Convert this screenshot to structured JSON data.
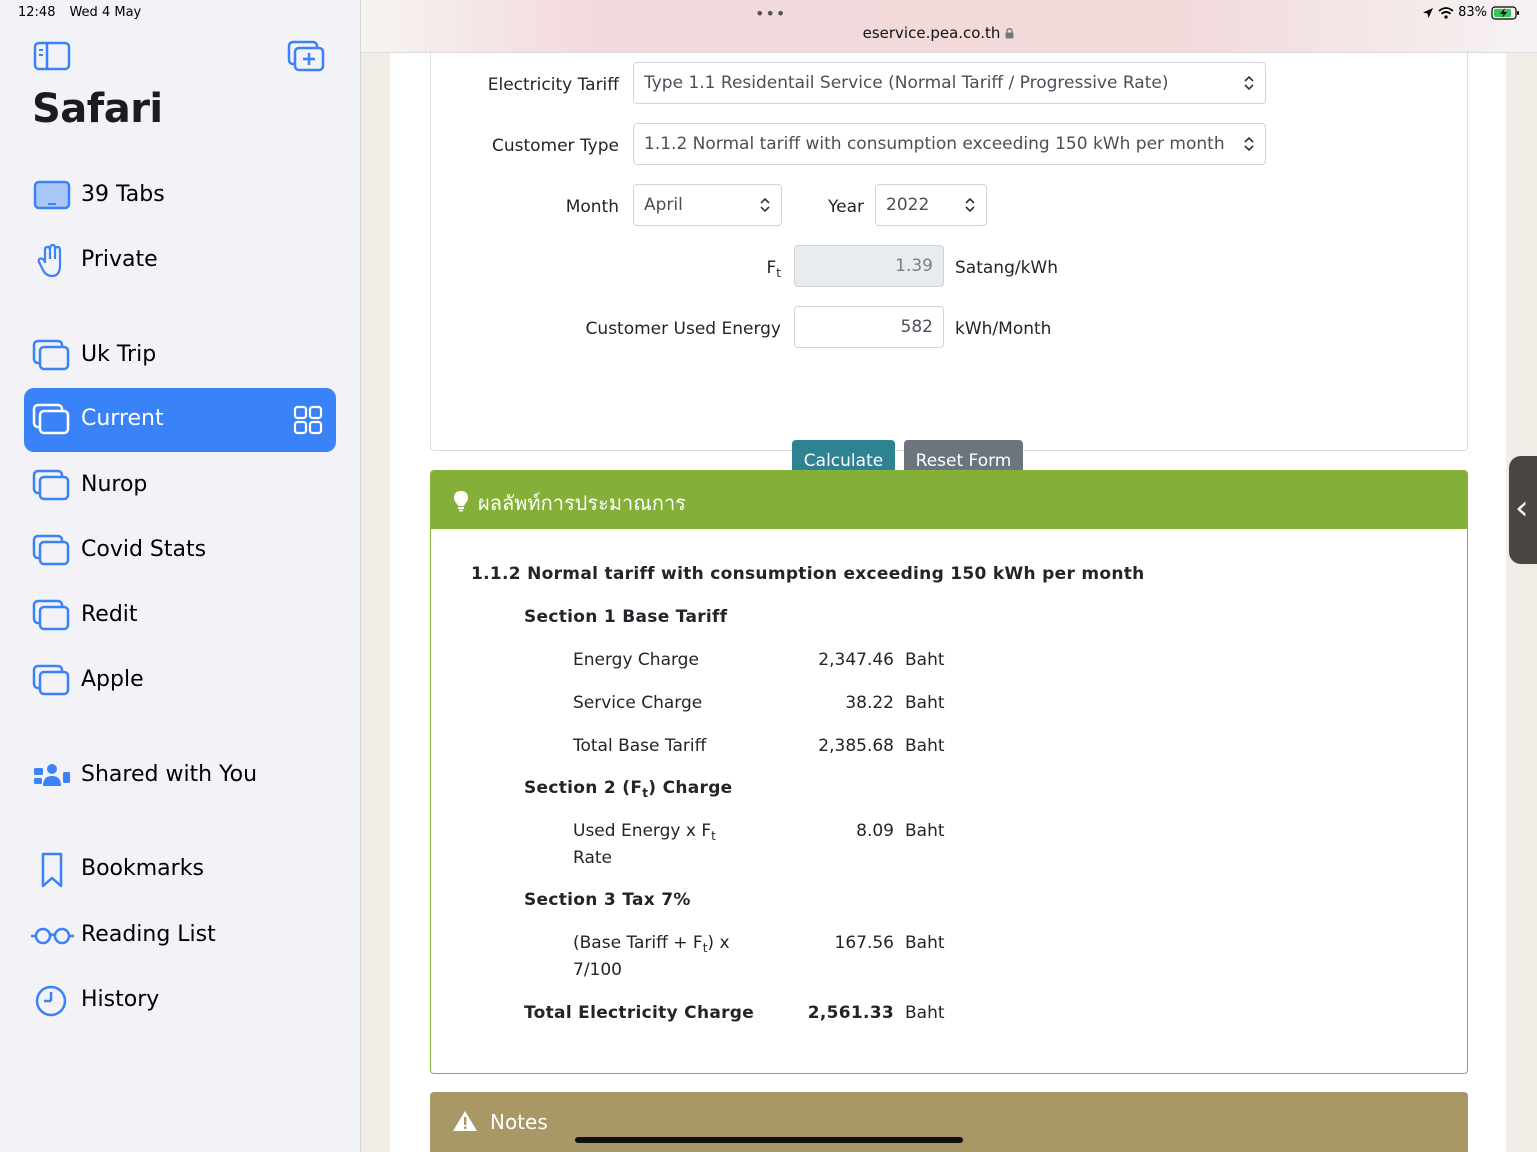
{
  "status_bar": {
    "time": "12:48",
    "date": "Wed 4 May",
    "battery": "83%"
  },
  "sidebar": {
    "title": "Safari",
    "items": [
      {
        "label": "39 Tabs",
        "icon": "tablet-icon"
      },
      {
        "label": "Private",
        "icon": "hand-icon"
      },
      {
        "label": "Uk Trip",
        "icon": "tab-group-icon"
      },
      {
        "label": "Current",
        "icon": "tab-group-icon",
        "active": true
      },
      {
        "label": "Nurop",
        "icon": "tab-group-icon"
      },
      {
        "label": "Covid Stats",
        "icon": "tab-group-icon"
      },
      {
        "label": "Redit",
        "icon": "tab-group-icon"
      },
      {
        "label": "Apple",
        "icon": "tab-group-icon"
      },
      {
        "label": "Shared with You",
        "icon": "shared-people-icon"
      },
      {
        "label": "Bookmarks",
        "icon": "bookmark-icon"
      },
      {
        "label": "Reading List",
        "icon": "glasses-icon"
      },
      {
        "label": "History",
        "icon": "clock-icon"
      }
    ]
  },
  "browser": {
    "url": "eservice.pea.co.th",
    "more": "•••"
  },
  "form": {
    "tariff_label": "Electricity Tariff",
    "tariff_value": "Type 1.1 Residentail Service (Normal Tariff / Progressive Rate)",
    "customer_type_label": "Customer Type",
    "customer_type_value": "1.1.2 Normal tariff with consumption exceeding 150 kWh per month",
    "month_label": "Month",
    "month_value": "April",
    "year_label": "Year",
    "year_value": "2022",
    "ft_label": "F",
    "ft_sub": "t",
    "ft_value": "1.39",
    "ft_unit": "Satang/kWh",
    "energy_label": "Customer Used Energy",
    "energy_value": "582",
    "energy_unit": "kWh/Month",
    "calculate": "Calculate",
    "reset": "Reset Form"
  },
  "result": {
    "header": "ผลลัพท์การประมาณการ",
    "heading": "1.1.2 Normal tariff with consumption exceeding 150 kWh per month",
    "section1": "Section 1 Base Tariff",
    "energy_charge_label": "Energy Charge",
    "energy_charge_value": "2,347.46",
    "service_charge_label": "Service Charge",
    "service_charge_value": "38.22",
    "total_base_label": "Total Base Tariff",
    "total_base_value": "2,385.68",
    "section2_a": "Section 2 (F",
    "section2_sub": "t",
    "section2_b": ") Charge",
    "ft_row_a": "Used Energy x F",
    "ft_row_sub": "t",
    "ft_row_b": "Rate",
    "ft_row_value": "8.09",
    "section3": "Section 3 Tax 7%",
    "tax_row_a": "(Base Tariff + F",
    "tax_row_sub": "t",
    "tax_row_b": ") x",
    "tax_row_c": "7/100",
    "tax_value": "167.56",
    "total_label": "Total Electricity Charge",
    "total_value": "2,561.33",
    "unit": "Baht"
  },
  "notes": {
    "title": "Notes"
  },
  "colors": {
    "accent": "#3a82f7",
    "result_green": "#84b03a",
    "notes_gold": "#a89865",
    "calc_button": "#2f8291"
  }
}
